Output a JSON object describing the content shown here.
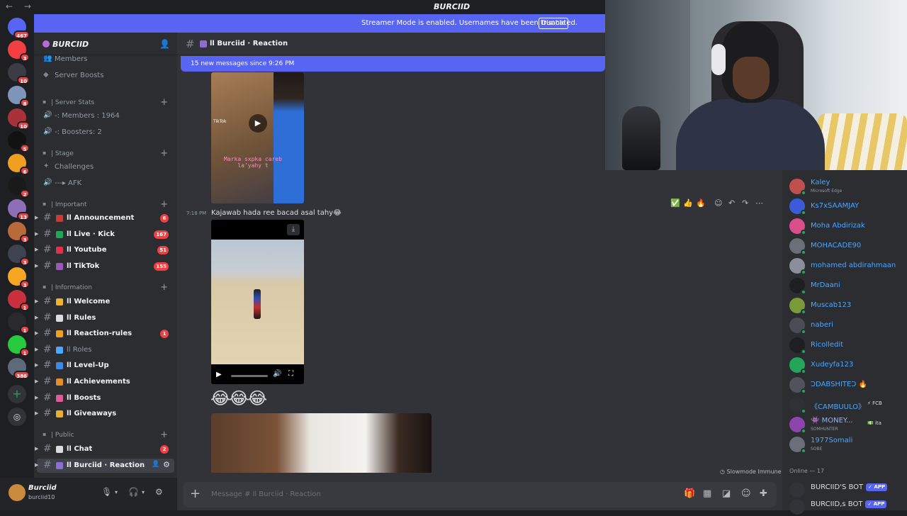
{
  "window": {
    "title": "BURCIID",
    "nav_arrows": "← →"
  },
  "streamer_banner": {
    "text": "Streamer Mode is enabled. Usernames have been truncated.",
    "button": "Disable"
  },
  "servers": [
    {
      "badge": "467",
      "color": "#5865f2",
      "icon": "discord-home-icon"
    },
    {
      "badge": "3",
      "color": "#f23f43",
      "icon": "server-icon"
    },
    {
      "badge": "10",
      "color": "#3b3b44",
      "icon": "server-icon"
    },
    {
      "badge": "8",
      "color": "#7e94b8",
      "icon": "server-icon"
    },
    {
      "badge": "10",
      "color": "#a8323a",
      "icon": "server-icon"
    },
    {
      "badge": "5",
      "color": "#121212",
      "icon": "server-icon"
    },
    {
      "badge": "6",
      "color": "#f0a020",
      "icon": "server-icon"
    },
    {
      "badge": "2",
      "color": "#1a1a1a",
      "icon": "server-icon"
    },
    {
      "badge": "13",
      "color": "#8e6fb5",
      "icon": "server-icon"
    },
    {
      "badge": "3",
      "color": "#b86a3a",
      "icon": "server-icon"
    },
    {
      "badge": "3",
      "color": "#3f4350",
      "icon": "server-icon"
    },
    {
      "badge": "3",
      "color": "#f5a623",
      "icon": "server-icon"
    },
    {
      "badge": "1",
      "color": "#c9303e",
      "icon": "server-icon"
    },
    {
      "badge": "1",
      "color": "#2a2a2e",
      "icon": "server-icon"
    },
    {
      "badge": "1",
      "color": "#27c93f",
      "icon": "server-icon"
    },
    {
      "badge": "386",
      "color": "#5d6a7a",
      "icon": "server-icon"
    }
  ],
  "guild": {
    "name": "BURCIID",
    "top_items": [
      "Members",
      "Server Boosts"
    ],
    "categories": {
      "server_stats": "| Server Stats",
      "stage": "| Stage",
      "important": "| Important",
      "information": "| Information",
      "public": "| Public"
    },
    "stats": [
      "-: Members : 1964",
      "-: Boosters: 2"
    ],
    "stage_items": [
      "Challenges",
      "---▸ AFK"
    ],
    "important": [
      {
        "label": "ll Announcement",
        "count": "6",
        "color": "#c43c3c"
      },
      {
        "label": "ll Live · Kick",
        "count": "167",
        "color": "#23a55a"
      },
      {
        "label": "ll Youtube",
        "count": "51",
        "color": "#e0314b"
      },
      {
        "label": "ll TikTok",
        "count": "155",
        "color": "#9b59b6"
      }
    ],
    "information": [
      {
        "label": "ll Welcome",
        "count": "",
        "color": "#f0b232",
        "dim": false
      },
      {
        "label": "ll Rules",
        "count": "",
        "color": "#dbdee1",
        "dim": false
      },
      {
        "label": "ll Reaction-rules",
        "count": "1",
        "color": "#f0a020",
        "dim": false
      },
      {
        "label": "ll Roles",
        "count": "",
        "color": "#4ea6ff",
        "dim": true
      },
      {
        "label": "ll Level-Up",
        "count": "",
        "color": "#3c8ae8",
        "dim": false
      },
      {
        "label": "ll Achievements",
        "count": "",
        "color": "#e68a2e",
        "dim": false
      },
      {
        "label": "ll Boosts",
        "count": "",
        "color": "#e05a9a",
        "dim": false
      },
      {
        "label": "ll Giveaways",
        "count": "",
        "color": "#e8b030",
        "dim": false
      }
    ],
    "public": [
      {
        "label": "ll Chat",
        "count": "2",
        "color": "#dbdee1"
      },
      {
        "label": "ll Burciid · Reaction",
        "count": "",
        "color": "#8b6fd0"
      }
    ]
  },
  "user_panel": {
    "name": "Burciid",
    "status": "burciid10"
  },
  "channel": {
    "name": "ll Burciid · Reaction",
    "new_messages": "15 new messages since 9:26 PM",
    "message_time": "7:18 PM",
    "message_text": "Kajawab hada ree  bacad asal tahy😂",
    "video1_caption": "Marka sxpka careb la'yahy t",
    "video1_watermark": "TikTok",
    "emoji_message": "😂😂😂",
    "slowmode": "Slowmode Immune",
    "composer_placeholder": "Message # ll Burciid · Reaction",
    "reactions": [
      "✅",
      "👍",
      "🔥"
    ]
  },
  "members": [
    {
      "name": "Kaley",
      "sub": "Microsoft Edge",
      "color": "#c0504d",
      "name_color": "#4ea6ff"
    },
    {
      "name": "Ks7xSAAMJAY",
      "sub": "",
      "color": "#3b5bdb",
      "name_color": "#4ea6ff"
    },
    {
      "name": "Moha Abdirizak",
      "sub": "",
      "color": "#d94f8a",
      "name_color": "#4ea6ff"
    },
    {
      "name": "MOHACADE90",
      "sub": "",
      "color": "#6a6f7a",
      "name_color": "#4ea6ff"
    },
    {
      "name": "mohamed abdirahmaan",
      "sub": "",
      "color": "#8a8f99",
      "name_color": "#4ea6ff"
    },
    {
      "name": "MrDaani",
      "sub": "",
      "color": "#1e1f22",
      "name_color": "#4ea6ff"
    },
    {
      "name": "Muscab123",
      "sub": "",
      "color": "#7a9a3a",
      "name_color": "#4ea6ff"
    },
    {
      "name": "naberi",
      "sub": "",
      "color": "#4a4d55",
      "name_color": "#4ea6ff"
    },
    {
      "name": "Ricolledit",
      "sub": "",
      "color": "#1e1f22",
      "name_color": "#4ea6ff"
    },
    {
      "name": "Xudeyfa123",
      "sub": "",
      "color": "#23a55a",
      "name_color": "#4ea6ff"
    },
    {
      "name": "ƆDABSHITEƆ 🔥",
      "sub": "",
      "color": "#50535b",
      "name_color": "#4ea6ff"
    },
    {
      "name": "《CAMBUULO》",
      "sub": "",
      "color": "#2f3136",
      "name_color": "#4ea6ff",
      "tag": "⚡ FCB"
    },
    {
      "name": "👾 MONEY...",
      "sub": "SOMHUNTER",
      "color": "#8e44ad",
      "name_color": "#8fb4ff",
      "tag": "💵 ita"
    },
    {
      "name": "1977Somali",
      "sub": "SOBE",
      "color": "#6a6f7a",
      "name_color": "#4ea6ff"
    }
  ],
  "online_header": "Online — 17",
  "bots": [
    {
      "name": "BURCIID'S BOT",
      "badge": "✓ APP"
    },
    {
      "name": "BURCIID,s BOT",
      "badge": "✓ APP"
    }
  ],
  "colors": {
    "accent": "#5865f2",
    "danger": "#f23f43",
    "online": "#23a55a",
    "member_name": "#4ea6ff"
  }
}
